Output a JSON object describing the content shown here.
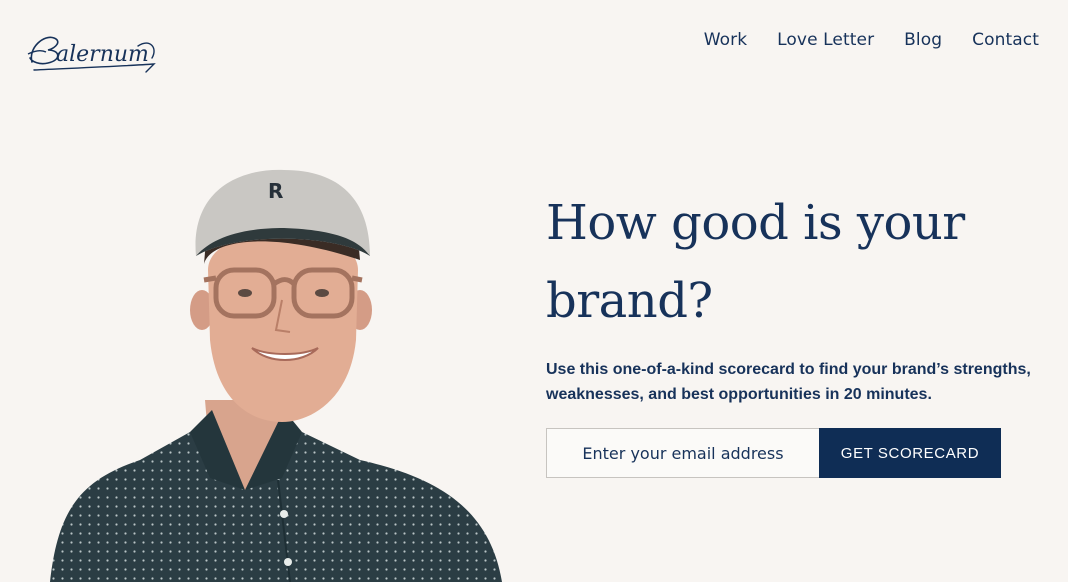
{
  "header": {
    "logo_text": "Balernum",
    "nav": [
      {
        "label": "Work"
      },
      {
        "label": "Love Letter"
      },
      {
        "label": "Blog"
      },
      {
        "label": "Contact"
      }
    ]
  },
  "hero": {
    "headline_line1": "How good is your",
    "headline_line2": "brand?",
    "subcopy_line1": "Use this one-of-a-kind scorecard to find your brand’s strengths,",
    "subcopy_line2": "weaknesses, and best opportunities in 20 minutes.",
    "email_placeholder": "Enter your email address",
    "cta_label": "GET SCORECARD",
    "cap_letter": "R"
  },
  "colors": {
    "background": "#f8f5f2",
    "brand_navy": "#17325a",
    "button_navy": "#0f2d55"
  }
}
